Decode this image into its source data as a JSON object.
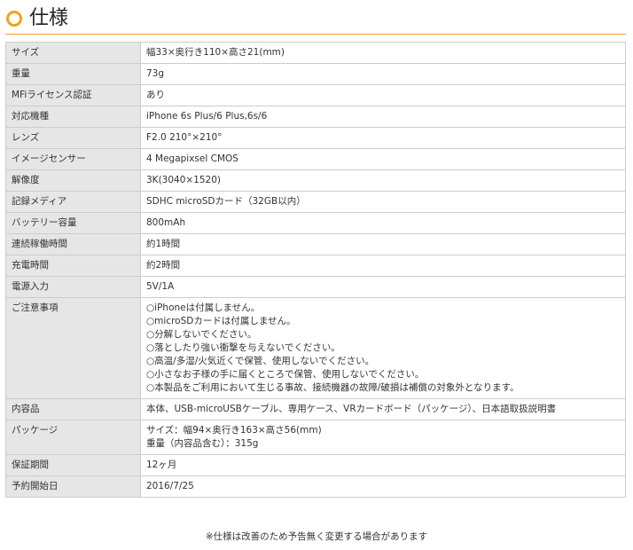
{
  "header": {
    "title": "仕様"
  },
  "spec": [
    {
      "label": "サイズ",
      "lines": [
        "幅33×奥行き110×高さ21(mm)"
      ]
    },
    {
      "label": "重量",
      "lines": [
        "73g"
      ]
    },
    {
      "label": "MFiライセンス認証",
      "lines": [
        "あり"
      ]
    },
    {
      "label": "対応機種",
      "lines": [
        "iPhone 6s Plus/6 Plus,6s/6"
      ]
    },
    {
      "label": "レンズ",
      "lines": [
        "F2.0 210°×210°"
      ]
    },
    {
      "label": "イメージセンサー",
      "lines": [
        "4 Megapixsel CMOS"
      ]
    },
    {
      "label": "解像度",
      "lines": [
        "3K(3040×1520)"
      ]
    },
    {
      "label": "記録メディア",
      "lines": [
        "SDHC microSDカード（32GB以内）"
      ]
    },
    {
      "label": "バッテリー容量",
      "lines": [
        "800mAh"
      ]
    },
    {
      "label": "連続稼働時間",
      "lines": [
        "約1時間"
      ]
    },
    {
      "label": "充電時間",
      "lines": [
        "約2時間"
      ]
    },
    {
      "label": "電源入力",
      "lines": [
        "5V/1A"
      ]
    },
    {
      "label": "ご注意事項",
      "lines": [
        "○iPhoneは付属しません。",
        "○microSDカードは付属しません。",
        "○分解しないでください。",
        "○落としたり強い衝撃を与えないでください。",
        "○高温/多湿/火気近くで保管、使用しないでください。",
        "○小さなお子様の手に届くところで保管、使用しないでください。",
        "○本製品をご利用において生じる事故、接続機器の故障/破損は補償の対象外となります。"
      ]
    },
    {
      "label": "内容品",
      "lines": [
        "本体、USB-microUSBケーブル、専用ケース、VRカードボード（パッケージ）、日本語取扱説明書"
      ]
    },
    {
      "label": "パッケージ",
      "lines": [
        "サイズ：幅94×奥行き163×高さ56(mm)",
        "重量（内容品含む）：315g"
      ]
    },
    {
      "label": "保証期間",
      "lines": [
        "12ヶ月"
      ]
    },
    {
      "label": "予約開始日",
      "lines": [
        "2016/7/25"
      ]
    }
  ],
  "footnote": "※仕様は改善のため予告無く変更する場合があります"
}
